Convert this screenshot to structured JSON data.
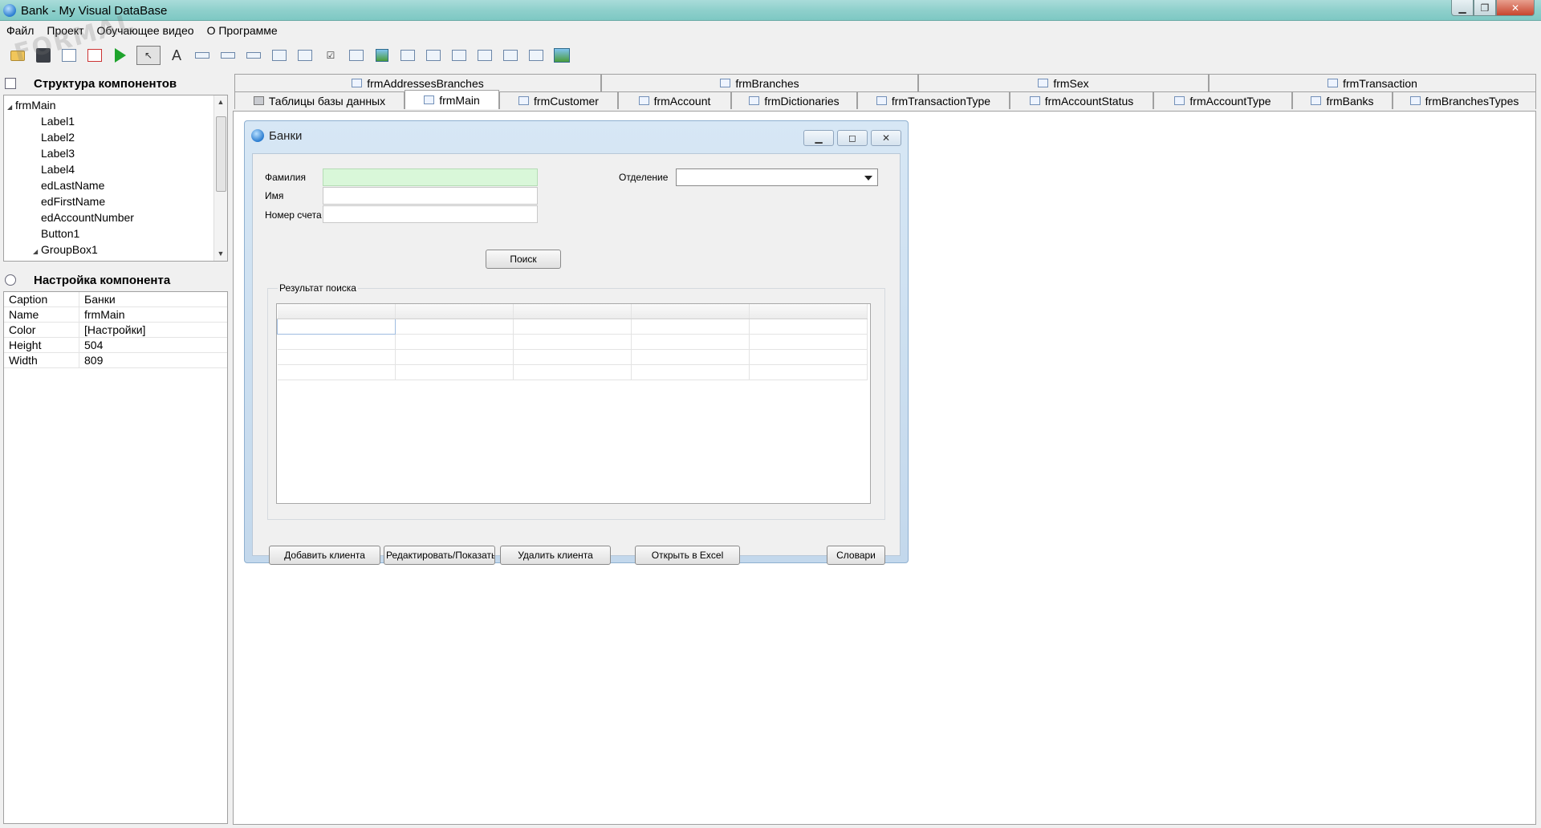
{
  "window": {
    "title": "Bank - My Visual DataBase"
  },
  "menu": [
    "Файл",
    "Проект",
    "Обучающее видео",
    "О Программе"
  ],
  "watermark": "FORMAL",
  "left_panel": {
    "structure_title": "Структура компонентов",
    "tree": [
      {
        "label": "frmMain",
        "level": 0,
        "expanded": true
      },
      {
        "label": "Label1",
        "level": 1
      },
      {
        "label": "Label2",
        "level": 1
      },
      {
        "label": "Label3",
        "level": 1
      },
      {
        "label": "Label4",
        "level": 1
      },
      {
        "label": "edLastName",
        "level": 1
      },
      {
        "label": "edFirstName",
        "level": 1
      },
      {
        "label": "edAccountNumber",
        "level": 1
      },
      {
        "label": "Button1",
        "level": 1
      },
      {
        "label": "GroupBox1",
        "level": 1,
        "expanded": true
      }
    ],
    "settings_title": "Настройка компонента",
    "properties": [
      {
        "key": "Caption",
        "value": "Банки"
      },
      {
        "key": "Name",
        "value": "frmMain"
      },
      {
        "key": "Color",
        "value": "[Настройки]"
      },
      {
        "key": "Height",
        "value": "504"
      },
      {
        "key": "Width",
        "value": "809"
      }
    ]
  },
  "tabs": {
    "row1": [
      "frmAddressesBranches",
      "frmBranches",
      "frmSex",
      "frmTransaction"
    ],
    "row2": [
      "Таблицы базы данных",
      "frmMain",
      "frmCustomer",
      "frmAccount",
      "frmDictionaries",
      "frmTransactionType",
      "frmAccountStatus",
      "frmAccountType",
      "frmBanks",
      "frmBranchesTypes"
    ],
    "active": "frmMain"
  },
  "form": {
    "title": "Банки",
    "labels": {
      "lastname": "Фамилия",
      "firstname": "Имя",
      "account": "Номер счета",
      "branch": "Отделение"
    },
    "search_button": "Поиск",
    "group_caption": "Результат поиска",
    "buttons": {
      "add": "Добавить клиента",
      "edit": "Редактировать/Показать",
      "delete": "Удалить клиента",
      "excel": "Открыть в Excel",
      "dicts": "Словари"
    }
  }
}
